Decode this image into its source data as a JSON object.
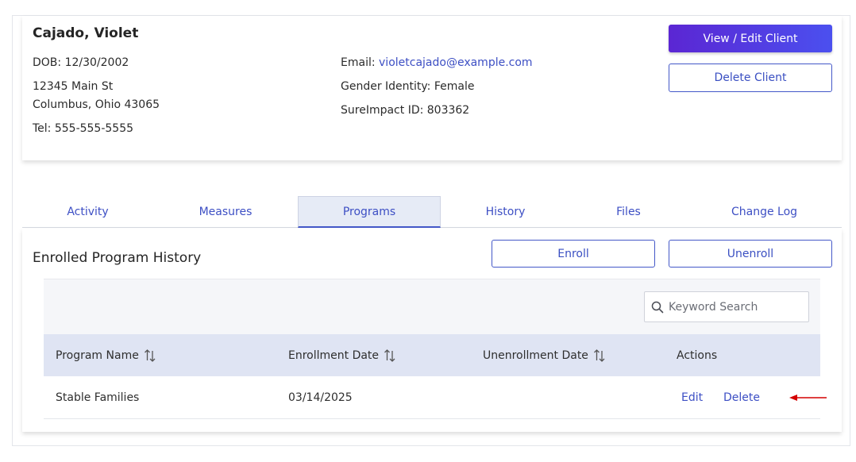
{
  "client": {
    "name": "Cajado, Violet",
    "dob": "DOB: 12/30/2002",
    "address_line1": "12345 Main St",
    "address_line2": "Columbus, Ohio 43065",
    "tel": "Tel: 555-555-5555",
    "email_label": "Email: ",
    "email": "violetcajado@example.com",
    "gender": "Gender Identity: Female",
    "sureimpact_id": "SureImpact ID: 803362",
    "view_edit_label": "View / Edit Client",
    "delete_label": "Delete Client"
  },
  "tabs": [
    {
      "label": "Activity"
    },
    {
      "label": "Measures"
    },
    {
      "label": "Programs"
    },
    {
      "label": "History"
    },
    {
      "label": "Files"
    },
    {
      "label": "Change Log"
    }
  ],
  "active_tab": "Programs",
  "programs": {
    "title": "Enrolled Program History",
    "enroll_label": "Enroll",
    "unenroll_label": "Unenroll",
    "search_placeholder": "Keyword Search",
    "search_value": "",
    "columns": [
      "Program Name",
      "Enrollment Date",
      "Unenrollment Date",
      "Actions"
    ],
    "rows": [
      {
        "program_name": "Stable Families",
        "enrollment_date": "03/14/2025",
        "unenrollment_date": "",
        "edit_label": "Edit",
        "delete_label": "Delete"
      }
    ]
  },
  "colors": {
    "accent": "#3d4fc4",
    "primary_button_start": "#5b26d3",
    "primary_button_end": "#4b50ef",
    "table_header_bg": "#dfe4f3",
    "annotation_arrow": "#d40000"
  },
  "icons": {
    "search": "search-icon",
    "sort": "sort-icon",
    "annotation": "arrow-left-annotation"
  }
}
